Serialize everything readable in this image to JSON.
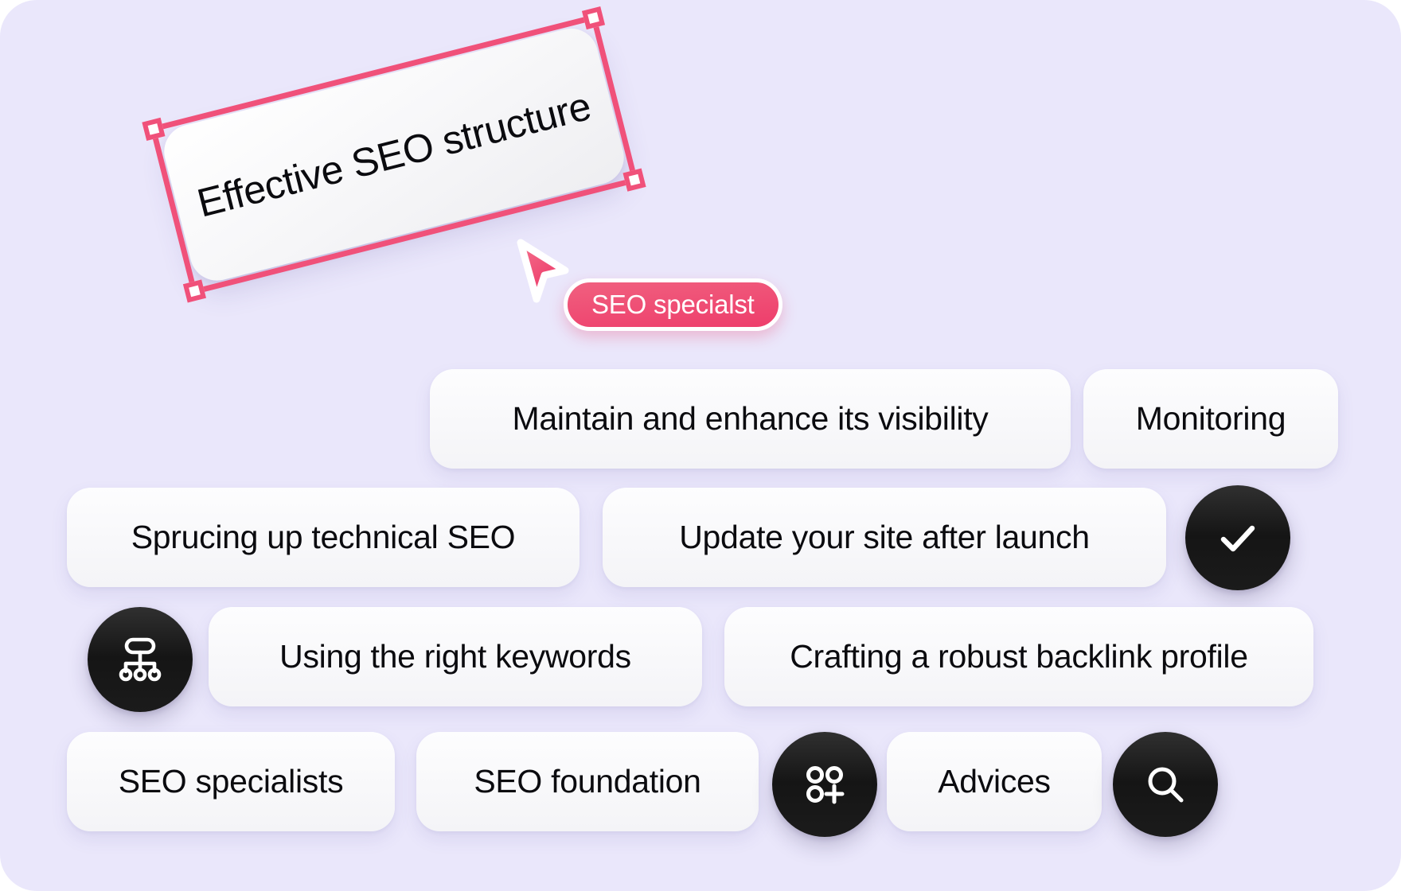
{
  "canvas": {
    "background_color": "#eae7fb",
    "accent_color": "#ee3d6b",
    "chip_color": "#f6f6f8",
    "dark_button_color": "#151515",
    "text_color": "#0b0b0f"
  },
  "selection": {
    "card_label": "Effective SEO structure",
    "handles": [
      "top-left",
      "top-right",
      "bottom-left",
      "bottom-right"
    ],
    "frame_color": "#f0517a"
  },
  "cursor": {
    "icon": "pointer-arrow-icon",
    "badge_label": "SEO specialst",
    "badge_color": "#ee3d6b"
  },
  "chips": [
    {
      "id": "maintain-visibility",
      "label": "Maintain and enhance its visibility"
    },
    {
      "id": "monitoring",
      "label": "Monitoring"
    },
    {
      "id": "technical-seo",
      "label": "Sprucing up technical SEO"
    },
    {
      "id": "update-site",
      "label": "Update your site after launch"
    },
    {
      "id": "right-keywords",
      "label": "Using the right keywords"
    },
    {
      "id": "backlink-profile",
      "label": "Crafting a robust backlink profile"
    },
    {
      "id": "seo-specialists",
      "label": "SEO specialists"
    },
    {
      "id": "seo-foundation",
      "label": "SEO foundation"
    },
    {
      "id": "advices",
      "label": "Advices"
    }
  ],
  "icon_buttons": [
    {
      "id": "check",
      "icon": "check-icon",
      "title": "Done"
    },
    {
      "id": "sitemap",
      "icon": "sitemap-icon",
      "title": "Structure"
    },
    {
      "id": "add-items",
      "icon": "add-grid-icon",
      "title": "Add"
    },
    {
      "id": "search",
      "icon": "search-icon",
      "title": "Search"
    }
  ]
}
